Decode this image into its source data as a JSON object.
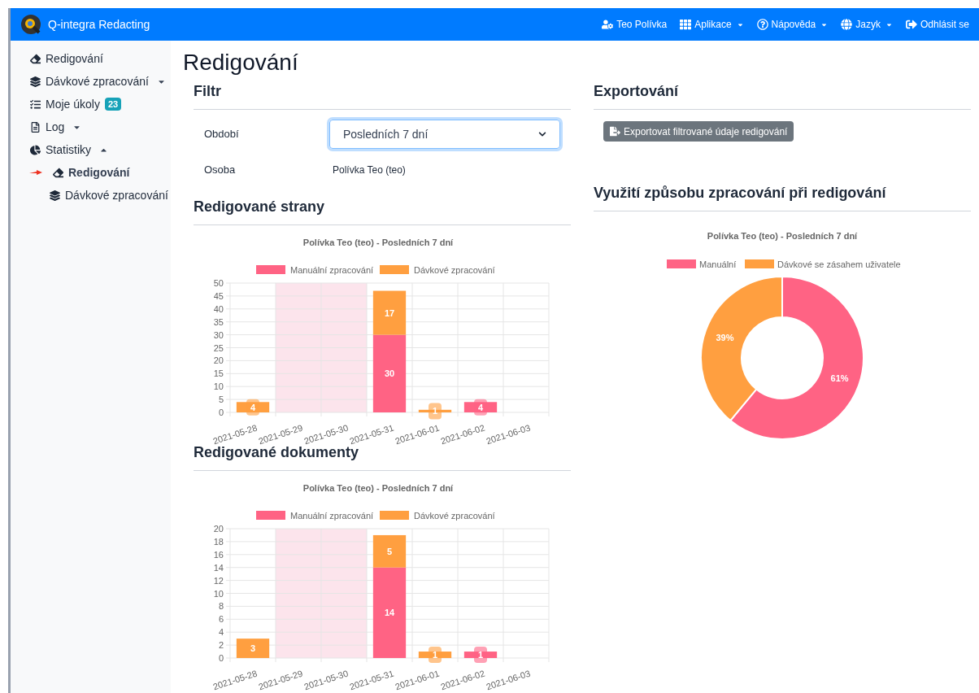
{
  "navbar": {
    "brand": "Q-integra Redacting",
    "items": [
      {
        "label": "Teo Polívka",
        "dropdown": false
      },
      {
        "label": "Aplikace",
        "dropdown": true
      },
      {
        "label": "Nápověda",
        "dropdown": true
      },
      {
        "label": "Jazyk",
        "dropdown": true
      },
      {
        "label": "Odhlásit se",
        "dropdown": false
      }
    ]
  },
  "sidebar": {
    "items": [
      {
        "label": "Redigování",
        "selected": false
      },
      {
        "label": "Dávkové zpracování",
        "selected": false,
        "expanded": false
      },
      {
        "label": "Moje úkoly",
        "selected": false,
        "badge": "23"
      },
      {
        "label": "Log",
        "selected": false,
        "expanded": false
      },
      {
        "label": "Statistiky",
        "selected": false,
        "expanded": true,
        "children": [
          {
            "label": "Redigování",
            "selected": true
          },
          {
            "label": "Dávkové zpracování",
            "selected": false
          }
        ]
      }
    ]
  },
  "page_title": "Redigování",
  "filter": {
    "title": "Filtr",
    "fields": [
      {
        "kind": "select",
        "label": "Období",
        "value": "Posledních 7 dní",
        "focused": true
      },
      {
        "kind": "text",
        "label": "Osoba",
        "value": "Polívka Teo (teo)"
      }
    ]
  },
  "export": {
    "title": "Exportování",
    "button": "Exportovat filtrované údaje redigování"
  },
  "pages_section": {
    "title": "Redigované strany",
    "chart_data": {
      "type": "bar",
      "stacked": true,
      "title": "Polívka Teo (teo) - Posledních 7 dní",
      "categories": [
        "2021-05-28",
        "2021-05-29",
        "2021-05-30",
        "2021-05-31",
        "2021-06-01",
        "2021-06-02",
        "2021-06-03"
      ],
      "series": [
        {
          "name": "Manuální zpracování",
          "color": "#ff6384",
          "values": [
            0,
            0,
            0,
            30,
            0,
            4,
            0
          ]
        },
        {
          "name": "Dávkové zpracování",
          "color": "#ff9f40",
          "values": [
            4,
            0,
            0,
            17,
            1,
            0,
            0
          ]
        }
      ],
      "ylim": [
        0,
        50
      ],
      "yticks": [
        0,
        5,
        10,
        15,
        20,
        25,
        30,
        35,
        40,
        45,
        50
      ],
      "grid": true,
      "legend": "top",
      "value_labels": [
        [
          null,
          null,
          null,
          "30",
          null,
          "4",
          null
        ],
        [
          "4",
          null,
          null,
          "17",
          "1",
          null,
          null
        ]
      ]
    }
  },
  "documents_section": {
    "title": "Redigované dokumenty",
    "chart_data": {
      "type": "bar",
      "stacked": true,
      "title": "Polívka Teo (teo) - Posledních 7 dní",
      "categories": [
        "2021-05-28",
        "2021-05-29",
        "2021-05-30",
        "2021-05-31",
        "2021-06-01",
        "2021-06-02",
        "2021-06-03"
      ],
      "series": [
        {
          "name": "Manuální zpracování",
          "color": "#ff6384",
          "values": [
            0,
            0,
            0,
            14,
            0,
            1,
            0
          ]
        },
        {
          "name": "Dávkové zpracování",
          "color": "#ff9f40",
          "values": [
            3,
            0,
            0,
            5,
            1,
            0,
            0
          ]
        }
      ],
      "ylim": [
        0,
        20
      ],
      "yticks": [
        0,
        2,
        4,
        6,
        8,
        10,
        12,
        14,
        16,
        18,
        20
      ],
      "grid": true,
      "legend": "top",
      "value_labels": [
        [
          null,
          null,
          null,
          "14",
          null,
          "1",
          null
        ],
        [
          "3",
          null,
          null,
          "5",
          "1",
          null,
          null
        ]
      ]
    }
  },
  "usage_section": {
    "title": "Využití způsobu zpracování při redigování",
    "chart_data": {
      "type": "donut",
      "title": "Polívka Teo (teo) - Posledních 7 dní",
      "legend": "top",
      "categories": [
        "Manuální",
        "Dávkové se zásahem uživatele"
      ],
      "values": [
        61,
        39
      ],
      "colors": [
        "#ff6384",
        "#ff9f40"
      ],
      "value_labels": [
        "61%",
        "39%"
      ]
    }
  }
}
